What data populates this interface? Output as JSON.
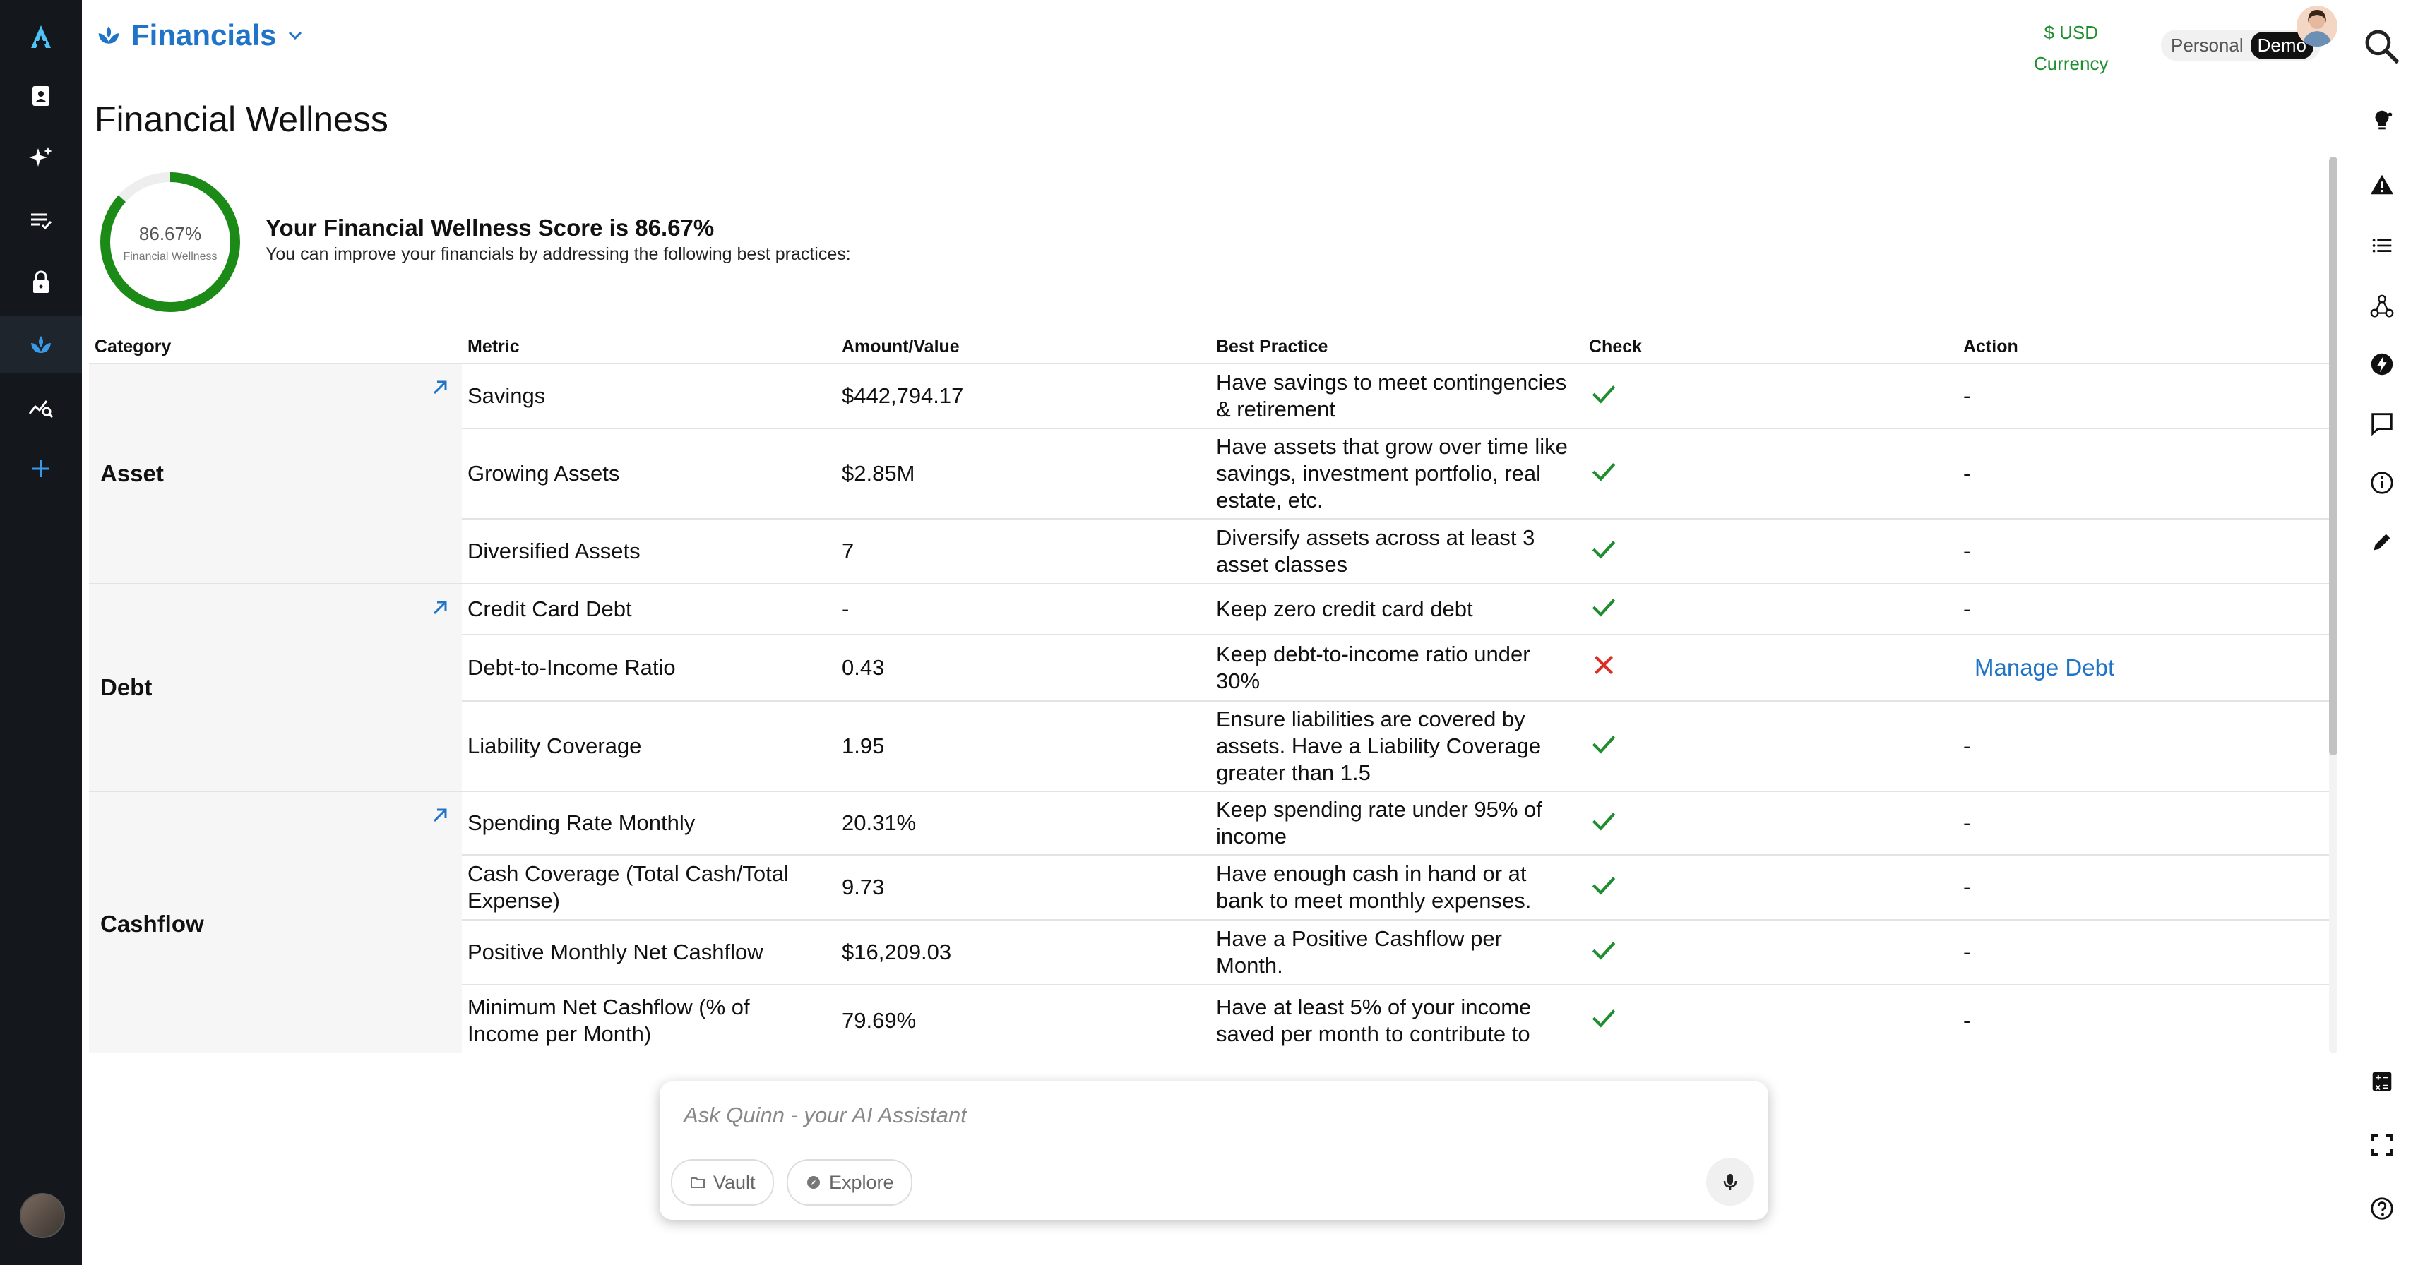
{
  "header": {
    "app_title": "Financials",
    "currency_value": "$ USD",
    "currency_label": "Currency",
    "profile_personal": "Personal",
    "profile_demo": "Demo"
  },
  "page": {
    "title": "Financial Wellness",
    "score_ring_value": "86.67%",
    "score_ring_label": "Financial Wellness",
    "score_percent": 86.67,
    "score_heading": "Your Financial Wellness Score is 86.67%",
    "score_subtext": "You can improve your financials by addressing the following best practices:"
  },
  "table": {
    "headers": [
      "Category",
      "Metric",
      "Amount/Value",
      "Best Practice",
      "Check",
      "Action"
    ],
    "groups": [
      {
        "category": "Asset",
        "rows": [
          {
            "metric": "Savings",
            "value": "$442,794.17",
            "practice": "Have savings to meet contingencies & retirement",
            "check": "pass",
            "action": "-"
          },
          {
            "metric": "Growing Assets",
            "value": "$2.85M",
            "practice": "Have assets that grow over time like savings, investment portfolio, real estate, etc.",
            "check": "pass",
            "action": "-"
          },
          {
            "metric": "Diversified Assets",
            "value": "7",
            "practice": "Diversify assets across at least 3 asset classes",
            "check": "pass",
            "action": "-"
          }
        ]
      },
      {
        "category": "Debt",
        "rows": [
          {
            "metric": "Credit Card Debt",
            "value": "-",
            "practice": "Keep zero credit card debt",
            "check": "pass",
            "action": "-"
          },
          {
            "metric": "Debt-to-Income Ratio",
            "value": "0.43",
            "practice": "Keep debt-to-income ratio under 30%",
            "check": "fail",
            "action": "Manage Debt"
          },
          {
            "metric": "Liability Coverage",
            "value": "1.95",
            "practice": "Ensure liabilities are covered by assets. Have a Liability Coverage greater than 1.5",
            "check": "pass",
            "action": "-"
          }
        ]
      },
      {
        "category": "Cashflow",
        "rows": [
          {
            "metric": "Spending Rate Monthly",
            "value": "20.31%",
            "practice": "Keep spending rate under 95% of income",
            "check": "pass",
            "action": "-"
          },
          {
            "metric": "Cash Coverage (Total Cash/Total Expense)",
            "value": "9.73",
            "practice": "Have enough cash in hand or at bank to meet monthly expenses.",
            "check": "pass",
            "action": "-"
          },
          {
            "metric": "Positive Monthly Net Cashflow",
            "value": "$16,209.03",
            "practice": "Have a Positive Cashflow per Month.",
            "check": "pass",
            "action": "-"
          },
          {
            "metric": "Minimum Net Cashflow (% of Income per Month)",
            "value": "79.69%",
            "practice": "Have at least 5% of your income saved per month to contribute to",
            "check": "pass",
            "action": "-"
          }
        ]
      }
    ]
  },
  "assistant": {
    "placeholder": "Ask Quinn - your AI Assistant",
    "vault_label": "Vault",
    "explore_label": "Explore"
  },
  "colors": {
    "brand_blue": "#1f74c7",
    "pass_green": "#1e8e2e",
    "fail_red": "#d93025",
    "sidebar_bg": "#14181d"
  }
}
